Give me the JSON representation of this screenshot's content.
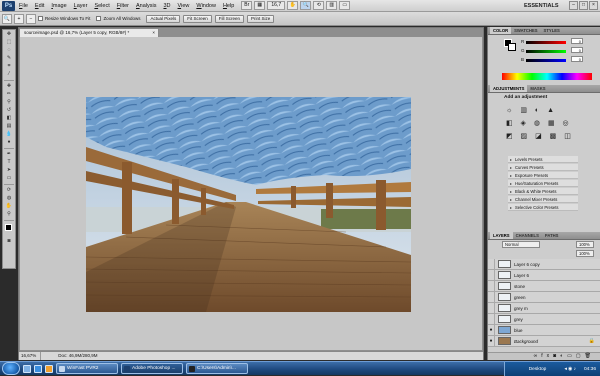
{
  "menu": {
    "app_icon": "Ps",
    "items": [
      "File",
      "Edit",
      "Image",
      "Layer",
      "Select",
      "Filter",
      "Analysis",
      "3D",
      "View",
      "Window",
      "Help"
    ],
    "zoom_value": "16,7",
    "workspace": "ESSENTIALS"
  },
  "options": {
    "checkboxes": [
      "Resize Windows To Fit",
      "Zoom All Windows"
    ],
    "buttons": [
      "Actual Pixels",
      "Fit Screen",
      "Fill Screen",
      "Print Size"
    ]
  },
  "document": {
    "tab_title": "sourceimage.psd @ 16,7% (Layer 5 copy, RGB/8#) *",
    "close": "×",
    "zoom": "16,67%",
    "doc_info": "Doc: 46,9M/280,9M"
  },
  "panels": {
    "color_tabs": [
      "COLOR",
      "SWATCHES",
      "STYLES"
    ],
    "color_channels": [
      "R",
      "G",
      "B"
    ],
    "color_values": [
      "0",
      "0",
      "0"
    ],
    "adjust_tabs": [
      "ADJUSTMENTS",
      "MASKS"
    ],
    "adjust_title": "Add an adjustment",
    "presets": [
      "Levels Presets",
      "Curves Presets",
      "Exposure Presets",
      "Hue/Saturation Presets",
      "Black & White Presets",
      "Channel Mixer Presets",
      "Selective Color Presets"
    ],
    "layers_tabs": [
      "LAYERS",
      "CHANNELS",
      "PATHS"
    ],
    "blend_mode": "Normal",
    "opacity": "100%",
    "fill": "100%",
    "layers": [
      {
        "name": "Layer 6 copy",
        "visible": false,
        "selected": false
      },
      {
        "name": "Layer 6",
        "visible": false,
        "selected": false
      },
      {
        "name": "stone",
        "visible": false,
        "selected": false
      },
      {
        "name": "green",
        "visible": false,
        "selected": false
      },
      {
        "name": "grey m",
        "visible": false,
        "selected": false
      },
      {
        "name": "grey",
        "visible": false,
        "selected": false
      },
      {
        "name": "blue",
        "visible": true,
        "selected": false
      },
      {
        "name": "Background",
        "visible": true,
        "selected": false
      }
    ]
  },
  "taskbar": {
    "tasks": [
      "WinFast PVR2",
      "Adobe Photoshop ...",
      "C:\\Users\\Admin\\..."
    ],
    "desktop_label": "Desktop",
    "clock": "04:36"
  },
  "colors": {
    "accent": "#5c82b8",
    "taskbar": "#1f4a80"
  }
}
